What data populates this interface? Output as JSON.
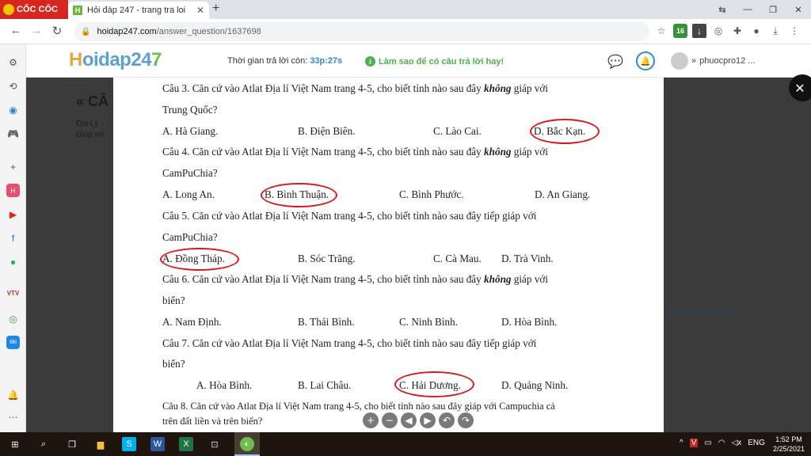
{
  "browser": {
    "brand_label": "CỐC CỐC",
    "tab_title": "Hỏi đáp 247 - trang tra loi",
    "tab_favicon": "H",
    "url_host": "hoidap247.com",
    "url_path": "/answer_question/1637698",
    "ext_badge": "16"
  },
  "site": {
    "logo_part1": "H",
    "logo_part2": "oidap24",
    "logo_part3": "7",
    "timer_label": "Thời gian trả lời còn:",
    "timer_value": "33p:27s",
    "howto_label": "Làm sao để có câu trả lời hay!",
    "username": "phuocpro12 ..."
  },
  "background_page": {
    "title": "« CÂ",
    "meta_line1": "Địa Lý · ",
    "meta_line2": "Giúp mì",
    "note": "đều được kiểm duyệt"
  },
  "document": {
    "lines": [
      {
        "segments": [
          "Câu 3. Căn cứ vào Atlat Địa lí Việt Nam trang 4-5, cho biết tỉnh nào sau đây ",
          "không",
          " giáp với"
        ]
      },
      {
        "segments": [
          "Trung Quốc?"
        ]
      },
      {
        "segments": [
          "Câu 4. Căn cứ vào Atlat Địa lí Việt Nam trang 4-5, cho biết tỉnh nào sau đây ",
          "không",
          " giáp với"
        ]
      },
      {
        "segments": [
          "CamPuChia?"
        ]
      },
      {
        "segments": [
          "Câu 5. Căn cứ vào Atlat Địa lí Việt Nam trang 4-5, cho biết tỉnh nào sau đây tiếp giáp với"
        ]
      },
      {
        "segments": [
          "CamPuChia?"
        ]
      },
      {
        "segments": [
          "Câu 6. Căn cứ vào Atlat Địa lí Việt Nam trang 4-5, cho biết tỉnh nào sau đây ",
          "không",
          " giáp với"
        ]
      },
      {
        "segments": [
          "biển?"
        ]
      },
      {
        "segments": [
          "Câu 7. Căn cứ vào Atlat Địa lí Việt Nam trang 4-5, cho biết tỉnh nào sau đây tiếp giáp với"
        ]
      },
      {
        "segments": [
          "biển?"
        ]
      },
      {
        "segments": [
          "Câu 8. Căn cứ vào Atlat Địa lí Việt Nam trang 4-5, cho biết tỉnh nào sau đây giáp với Campuchia cả"
        ]
      },
      {
        "segments": [
          "trên đất liền và trên biển?"
        ]
      }
    ],
    "answers": {
      "q3": [
        "A. Hà Giang.",
        "B. Điện Biên.",
        "C. Lào Cai.",
        "D. Bắc Kạn."
      ],
      "q4": [
        "A. Long An.",
        "B. Bình Thuận.",
        "C. Bình Phước.",
        "D. An Giang."
      ],
      "q5": [
        "A. Đồng Tháp.",
        "B. Sóc Trăng.",
        "C. Cà Mau.",
        "D. Trà Vinh."
      ],
      "q6": [
        "A. Nam Định.",
        "B. Thái Bình.",
        "C. Ninh Bình.",
        "D. Hòa Bình."
      ],
      "q7": [
        "A. Hòa Bình.",
        "B. Lai Châu.",
        "C. Hải Dương.",
        "D. Quảng Ninh."
      ]
    },
    "circled_answers": [
      "D. Bắc Kạn.",
      "B. Bình Thuận.",
      "A. Đồng Tháp.",
      "C. Hải Dương."
    ],
    "circle_color": "#d81b1b"
  },
  "viewer_controls": [
    "zoom-in",
    "zoom-out",
    "previous",
    "next",
    "rotate-left",
    "rotate-right"
  ],
  "taskbar": {
    "language": "ENG",
    "time": "1:52 PM",
    "date": "2/25/2021"
  }
}
